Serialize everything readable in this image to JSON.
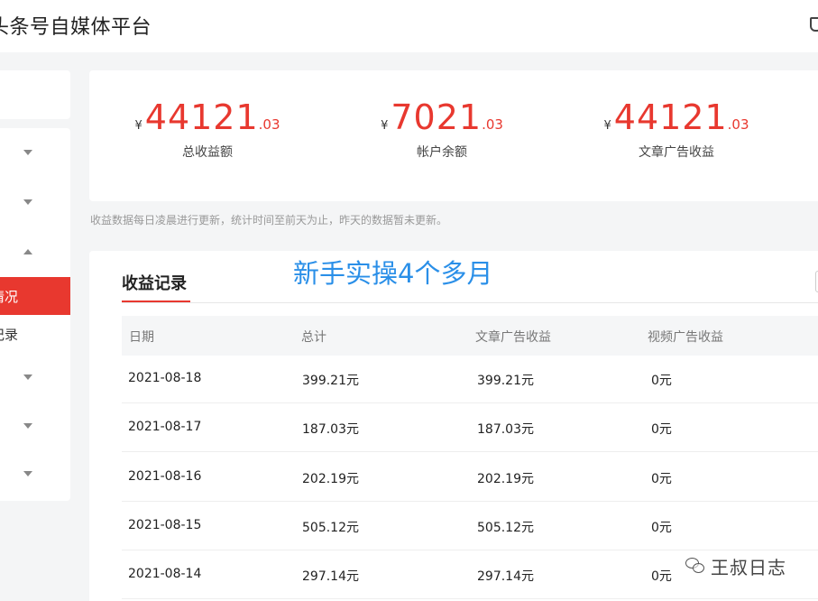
{
  "header": {
    "title": "头条号自媒体平台"
  },
  "sidebar": {
    "active_label": "情况",
    "sub_label": "记录"
  },
  "stats": [
    {
      "yen": "¥",
      "int": "44121",
      "dec": ".03",
      "label": "总收益额"
    },
    {
      "yen": "¥",
      "int": "7021",
      "dec": ".03",
      "label": "帐户余额"
    },
    {
      "yen": "¥",
      "int": "44121",
      "dec": ".03",
      "label": "文章广告收益"
    }
  ],
  "note": "收益数据每日凌晨进行更新，统计时间至前天为止，昨天的数据暂未更新。",
  "records": {
    "title": "收益记录",
    "overlay_caption": "新手实操4个多月",
    "columns": [
      "日期",
      "总计",
      "文章广告收益",
      "视频广告收益"
    ],
    "rows": [
      [
        "2021-08-18",
        "399.21元",
        "399.21元",
        "0元"
      ],
      [
        "2021-08-17",
        "187.03元",
        "187.03元",
        "0元"
      ],
      [
        "2021-08-16",
        "202.19元",
        "202.19元",
        "0元"
      ],
      [
        "2021-08-15",
        "505.12元",
        "505.12元",
        "0元"
      ],
      [
        "2021-08-14",
        "297.14元",
        "297.14元",
        "0元"
      ]
    ]
  },
  "watermark": {
    "icon": "wechat-icon",
    "text": "王叔日志"
  },
  "colors": {
    "accent": "#e8382f",
    "caption": "#2a8fe8"
  }
}
